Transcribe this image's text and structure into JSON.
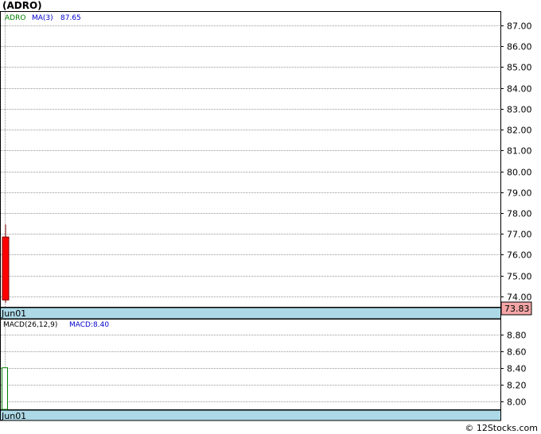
{
  "title": "(ADRO)",
  "watermark": "© 12Stocks.com",
  "chart_data": [
    {
      "type": "candlestick",
      "panel": "price",
      "legend": [
        {
          "text": "ADRO",
          "color": "#008000"
        },
        {
          "text": "MA(3)",
          "color": "#0000cc"
        },
        {
          "text": "87.65",
          "color": "#0000cc"
        }
      ],
      "x": [
        "Jun01"
      ],
      "candles": [
        {
          "date": "Jun01",
          "open": 76.85,
          "high": 77.45,
          "low": 73.7,
          "close": 73.83,
          "color": "#ff0000"
        }
      ],
      "last_price": "73.83",
      "y_ticks": [
        "74.00",
        "75.00",
        "76.00",
        "77.00",
        "78.00",
        "79.00",
        "80.00",
        "81.00",
        "82.00",
        "83.00",
        "84.00",
        "85.00",
        "86.00",
        "87.00"
      ],
      "ylim": [
        73.5,
        87.65
      ],
      "grid": true,
      "date_label": "Jun01"
    },
    {
      "type": "bar",
      "panel": "macd",
      "legend": [
        {
          "text": "MACD(26,12,9)",
          "color": "#000000"
        },
        {
          "text": "MACD:8.40",
          "color": "#0000cc"
        }
      ],
      "x": [
        "Jun01"
      ],
      "values": [
        8.4
      ],
      "y_ticks": [
        "8.00",
        "8.20",
        "8.40",
        "8.60",
        "8.80"
      ],
      "ylim": [
        7.9,
        8.98
      ],
      "grid": true,
      "date_label": "Jun01"
    }
  ]
}
